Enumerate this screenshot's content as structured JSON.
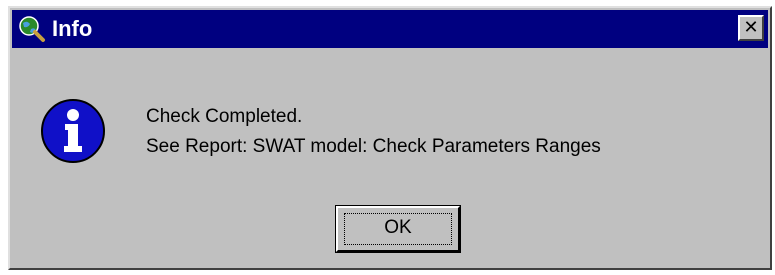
{
  "window": {
    "title": "Info",
    "title_icon": "globe-magnifier-icon",
    "close_glyph": "✕"
  },
  "dialog": {
    "icon": "info-icon",
    "message_line1": "Check Completed.",
    "message_line2": "See Report: SWAT model: Check Parameters Ranges",
    "ok_label": "OK"
  },
  "colors": {
    "titlebar": "#000080",
    "face": "#c0c0c0",
    "info_blue": "#1010c8"
  }
}
